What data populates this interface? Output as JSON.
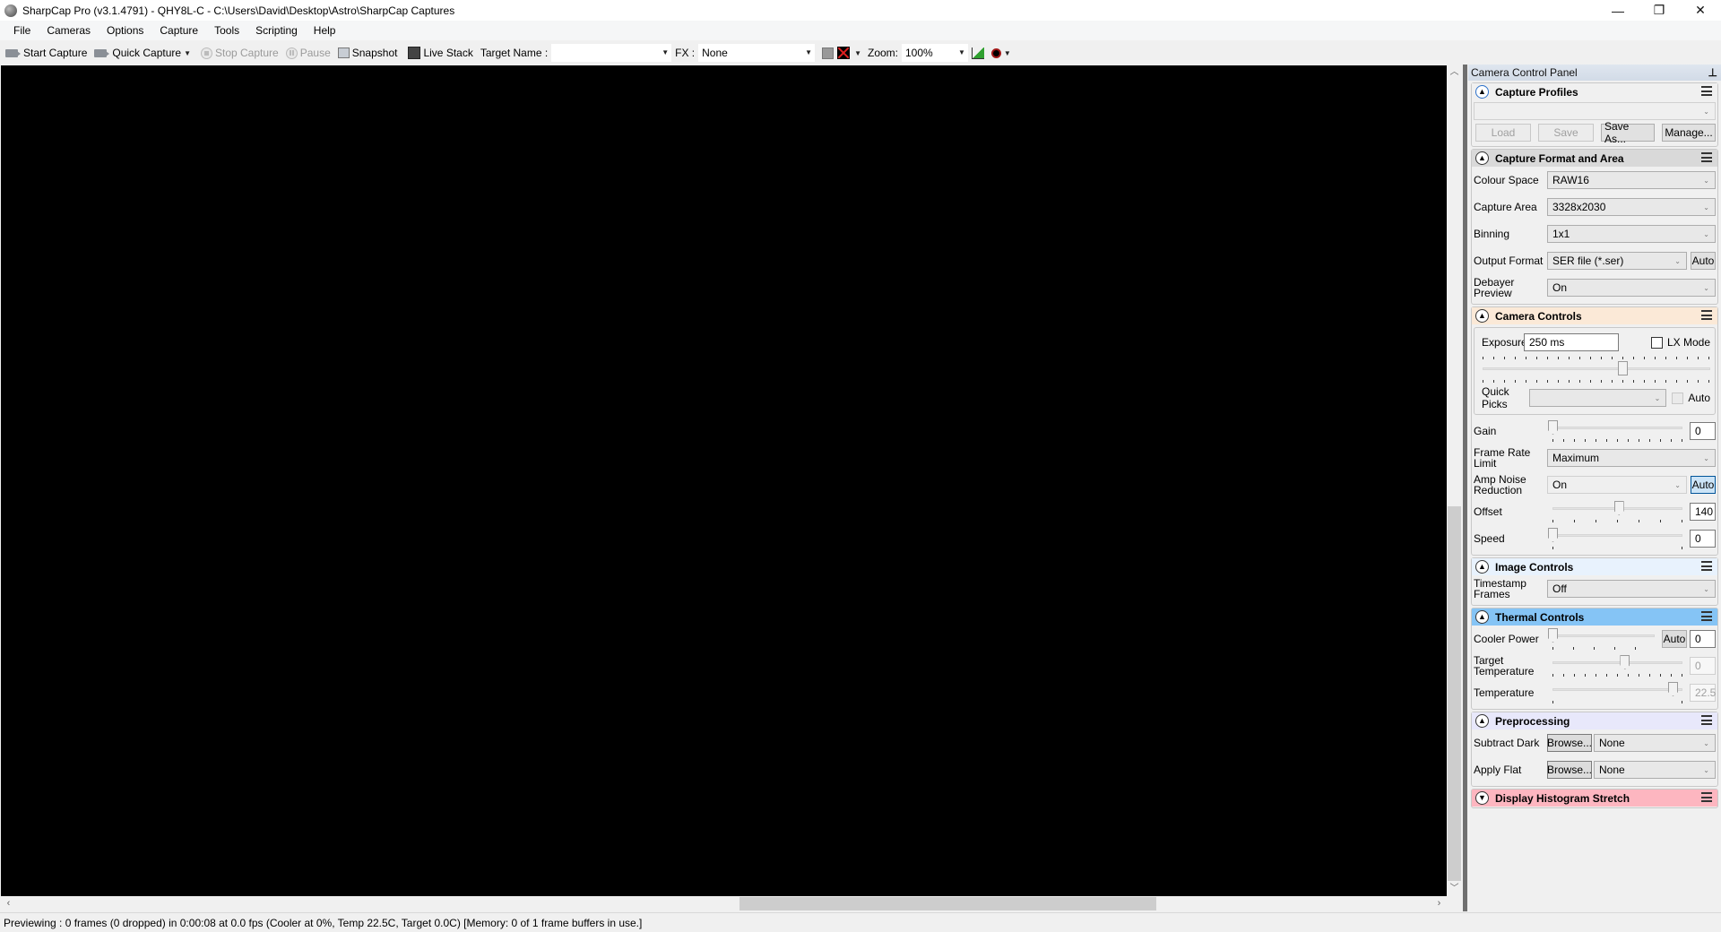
{
  "window": {
    "title": "SharpCap Pro (v3.1.4791) - QHY8L-C - C:\\Users\\David\\Desktop\\Astro\\SharpCap Captures",
    "controls": {
      "minimize": "—",
      "restore": "❐",
      "close": "✕"
    }
  },
  "menu": [
    "File",
    "Cameras",
    "Options",
    "Capture",
    "Tools",
    "Scripting",
    "Help"
  ],
  "toolbar": {
    "start_capture": "Start Capture",
    "quick_capture": "Quick Capture",
    "stop_capture": "Stop Capture",
    "pause": "Pause",
    "snapshot": "Snapshot",
    "live_stack": "Live Stack",
    "target_name_label": "Target Name :",
    "target_name_value": "",
    "fx_label": "FX :",
    "fx_value": "None",
    "zoom_label": "Zoom:",
    "zoom_value": "100%"
  },
  "status_bar": "Previewing : 0 frames (0 dropped) in 0:00:08 at 0.0 fps  (Cooler at 0%, Temp 22.5C, Target 0.0C) [Memory: 0 of 1 frame buffers in use.]",
  "panel": {
    "title": "Camera Control Panel",
    "capture_profiles": {
      "title": "Capture Profiles",
      "profile_value": "",
      "load": "Load",
      "save": "Save",
      "save_as": "Save As...",
      "manage": "Manage..."
    },
    "capture_format": {
      "title": "Capture Format and Area",
      "colour_space_label": "Colour Space",
      "colour_space": "RAW16",
      "capture_area_label": "Capture Area",
      "capture_area": "3328x2030",
      "binning_label": "Binning",
      "binning": "1x1",
      "output_format_label": "Output Format",
      "output_format": "SER file (*.ser)",
      "output_auto": "Auto",
      "debayer_label": "Debayer Preview",
      "debayer": "On"
    },
    "camera_controls": {
      "title": "Camera Controls",
      "exposure_label": "Exposure",
      "exposure": "250 ms",
      "lx_mode_label": "LX Mode",
      "lx_mode_checked": false,
      "exposure_slider_fraction": 0.64,
      "quick_picks_label": "Quick Picks",
      "quick_picks": "",
      "quick_picks_auto": "Auto",
      "gain_label": "Gain",
      "gain": "0",
      "gain_fraction": 0.0,
      "frame_rate_label": "Frame Rate Limit",
      "frame_rate": "Maximum",
      "amp_noise_label": "Amp Noise Reduction",
      "amp_noise": "On",
      "amp_noise_auto": "Auto",
      "offset_label": "Offset",
      "offset": "140",
      "offset_fraction": 0.55,
      "speed_label": "Speed",
      "speed": "0",
      "speed_fraction": 0.0
    },
    "image_controls": {
      "title": "Image Controls",
      "timestamp_label": "Timestamp Frames",
      "timestamp": "Off"
    },
    "thermal_controls": {
      "title": "Thermal Controls",
      "cooler_power_label": "Cooler Power",
      "cooler_power_auto": "Auto",
      "cooler_power": "0",
      "cooler_fraction": 0.0,
      "target_temp_label": "Target Temperature",
      "target_temp": "0",
      "target_temp_fraction": 0.6,
      "temperature_label": "Temperature",
      "temperature": "22.5",
      "temperature_fraction": 1.0
    },
    "preprocessing": {
      "title": "Preprocessing",
      "subtract_dark_label": "Subtract Dark",
      "subtract_dark_browse": "Browse...",
      "subtract_dark": "None",
      "apply_flat_label": "Apply Flat",
      "apply_flat_browse": "Browse...",
      "apply_flat": "None"
    },
    "histogram": {
      "title": "Display Histogram Stretch"
    }
  }
}
